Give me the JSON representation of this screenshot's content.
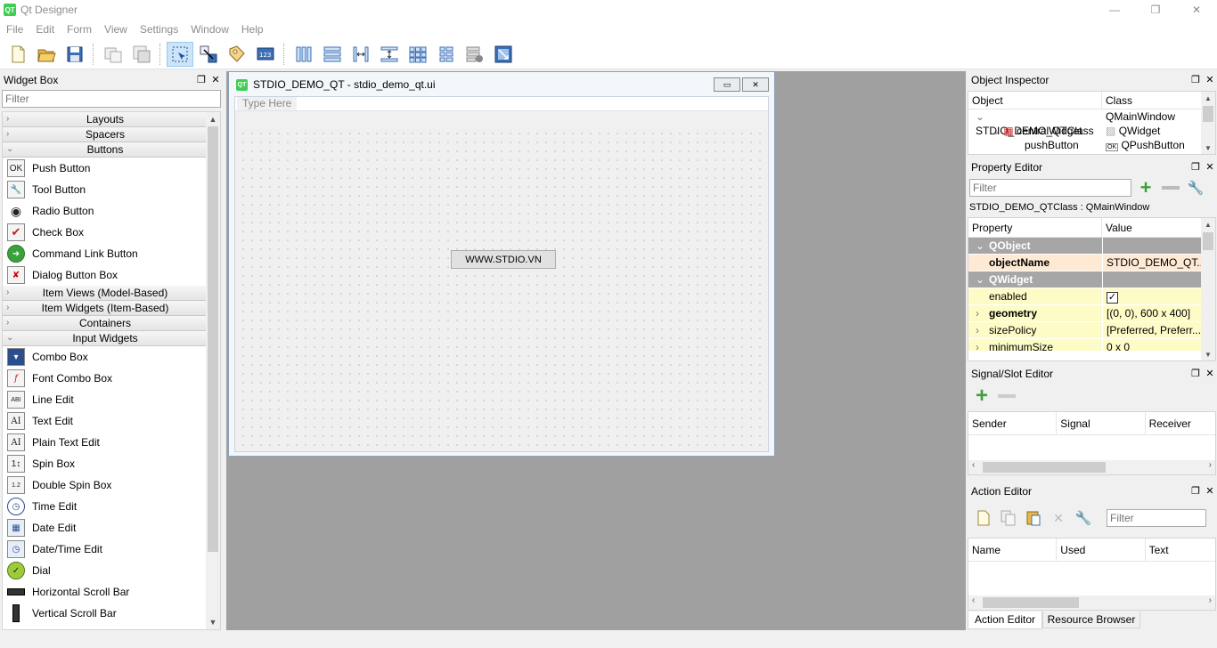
{
  "window": {
    "title": "Qt Designer",
    "app_icon": "QT",
    "minimize": "—",
    "maximize": "❐",
    "close": "✕"
  },
  "menu": [
    "File",
    "Edit",
    "Form",
    "View",
    "Settings",
    "Window",
    "Help"
  ],
  "toolbar": {
    "icons": [
      "new-file-icon",
      "open-folder-icon",
      "save-icon",
      "copy-window-icon",
      "paste-window-icon",
      "edit-widgets-icon",
      "edit-signals-slots-icon",
      "edit-buddies-icon",
      "edit-tab-order-icon",
      "layout-horizontal-icon",
      "layout-vertical-icon",
      "layout-horizontal-splitter-icon",
      "layout-vertical-splitter-icon",
      "layout-grid-icon",
      "layout-form-icon",
      "break-layout-icon",
      "adjust-size-icon"
    ]
  },
  "widget_box": {
    "title": "Widget Box",
    "filter_placeholder": "Filter",
    "categories": {
      "layouts": "Layouts",
      "spacers": "Spacers",
      "buttons": "Buttons",
      "item_views": "Item Views (Model-Based)",
      "item_widgets": "Item Widgets (Item-Based)",
      "containers": "Containers",
      "input_widgets": "Input Widgets"
    },
    "buttons_items": [
      "Push Button",
      "Tool Button",
      "Radio Button",
      "Check Box",
      "Command Link Button",
      "Dialog Button Box"
    ],
    "input_items": [
      "Combo Box",
      "Font Combo Box",
      "Line Edit",
      "Text Edit",
      "Plain Text Edit",
      "Spin Box",
      "Double Spin Box",
      "Time Edit",
      "Date Edit",
      "Date/Time Edit",
      "Dial",
      "Horizontal Scroll Bar",
      "Vertical Scroll Bar"
    ]
  },
  "form": {
    "title": "STDIO_DEMO_QT - stdio_demo_qt.ui",
    "menu_placeholder": "Type Here",
    "push_button_text": "WWW.STDIO.VN"
  },
  "object_inspector": {
    "title": "Object Inspector",
    "col_object": "Object",
    "col_class": "Class",
    "rows": [
      {
        "object": "STDIO_DEMO_QTClass",
        "class": "QMainWindow"
      },
      {
        "object": "centralWidget",
        "class": "QWidget"
      },
      {
        "object": "pushButton",
        "class": "QPushButton"
      }
    ]
  },
  "property_editor": {
    "title": "Property Editor",
    "filter_placeholder": "Filter",
    "context": "STDIO_DEMO_QTClass : QMainWindow",
    "col_property": "Property",
    "col_value": "Value",
    "group_qobject": "QObject",
    "group_qwidget": "QWidget",
    "object_name_label": "objectName",
    "object_name_value": "STDIO_DEMO_QT...",
    "enabled_label": "enabled",
    "enabled_value": true,
    "geometry_label": "geometry",
    "geometry_value": "[(0, 0), 600 x 400]",
    "size_policy_label": "sizePolicy",
    "size_policy_value": "[Preferred, Preferr...",
    "minimum_size_label": "minimumSize",
    "minimum_size_value": "0 x 0"
  },
  "signal_slot_editor": {
    "title": "Signal/Slot Editor",
    "col_sender": "Sender",
    "col_signal": "Signal",
    "col_receiver": "Receiver"
  },
  "action_editor": {
    "title": "Action Editor",
    "filter_placeholder": "Filter",
    "col_name": "Name",
    "col_used": "Used",
    "col_text": "Text"
  },
  "bottom_tabs": [
    "Action Editor",
    "Resource Browser"
  ]
}
